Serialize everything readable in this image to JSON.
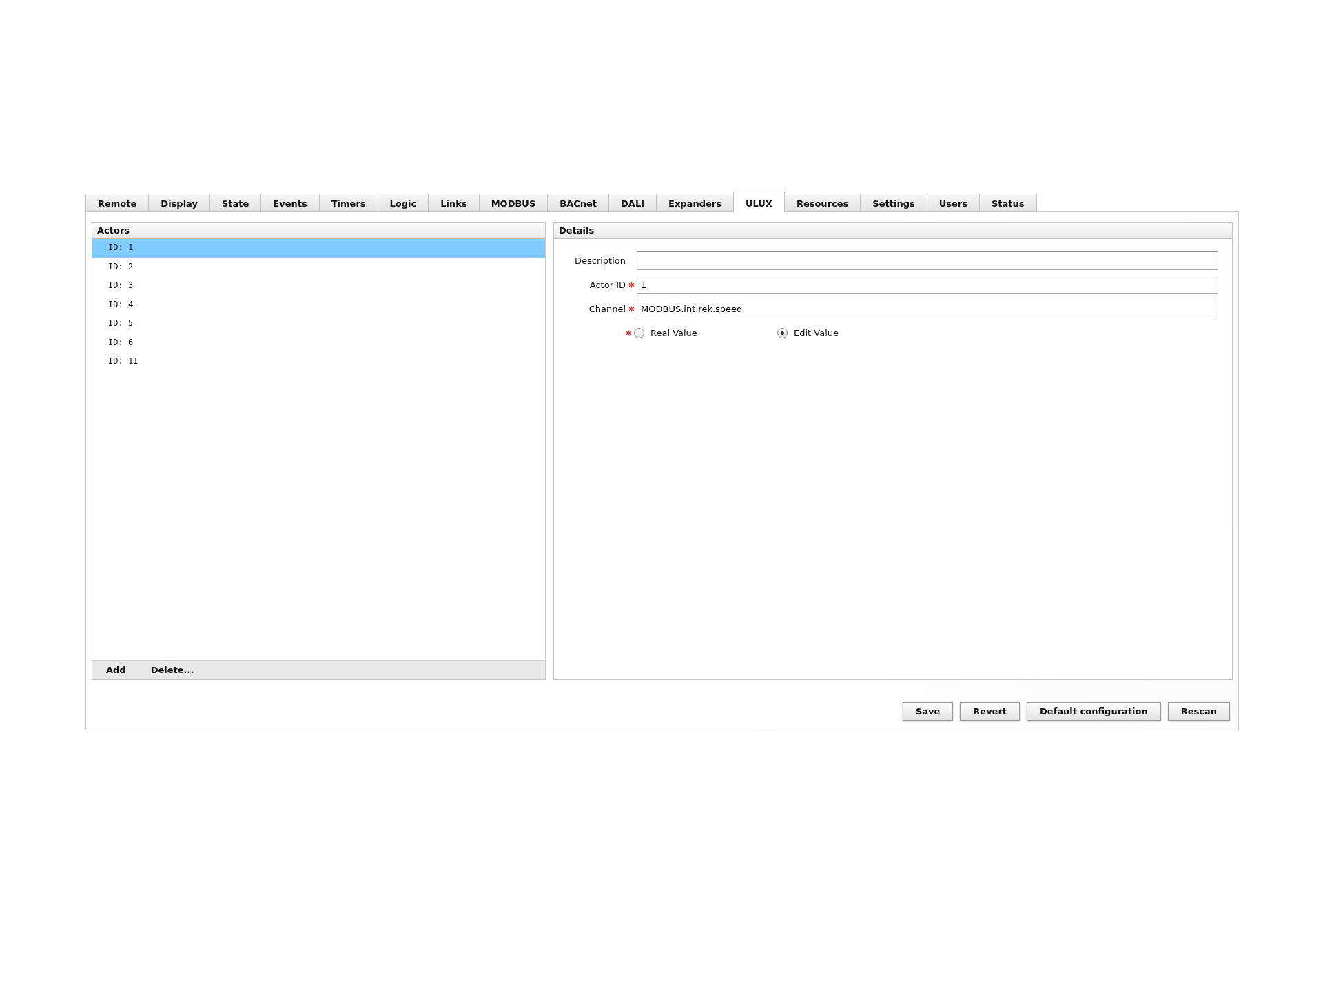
{
  "tabs": [
    {
      "label": "Remote",
      "selected": false
    },
    {
      "label": "Display",
      "selected": false
    },
    {
      "label": "State",
      "selected": false
    },
    {
      "label": "Events",
      "selected": false
    },
    {
      "label": "Timers",
      "selected": false
    },
    {
      "label": "Logic",
      "selected": false
    },
    {
      "label": "Links",
      "selected": false
    },
    {
      "label": "MODBUS",
      "selected": false
    },
    {
      "label": "BACnet",
      "selected": false
    },
    {
      "label": "DALI",
      "selected": false
    },
    {
      "label": "Expanders",
      "selected": false
    },
    {
      "label": "ULUX",
      "selected": true
    },
    {
      "label": "Resources",
      "selected": false
    },
    {
      "label": "Settings",
      "selected": false
    },
    {
      "label": "Users",
      "selected": false
    },
    {
      "label": "Status",
      "selected": false
    }
  ],
  "actors": {
    "title": "Actors",
    "items": [
      {
        "label": "ID: 1",
        "selected": true
      },
      {
        "label": "ID: 2",
        "selected": false
      },
      {
        "label": "ID: 3",
        "selected": false
      },
      {
        "label": "ID: 4",
        "selected": false
      },
      {
        "label": "ID: 5",
        "selected": false
      },
      {
        "label": "ID: 6",
        "selected": false
      },
      {
        "label": "ID: 11",
        "selected": false
      }
    ],
    "footer_buttons": [
      "Add",
      "Delete..."
    ]
  },
  "details": {
    "title": "Details",
    "fields": [
      {
        "label": "Description",
        "required": false
      },
      {
        "label": "Actor ID",
        "required": true,
        "value": "1"
      },
      {
        "label": "Channel",
        "required": true,
        "value": "MODBUS.int.rek.speed"
      }
    ],
    "value_mode": {
      "required": true,
      "options": [
        {
          "label": "Real Value",
          "selected": false
        },
        {
          "label": "Edit Value",
          "selected": true
        }
      ]
    }
  },
  "buttons": [
    "Save",
    "Revert",
    "Default configuration",
    "Rescan"
  ]
}
